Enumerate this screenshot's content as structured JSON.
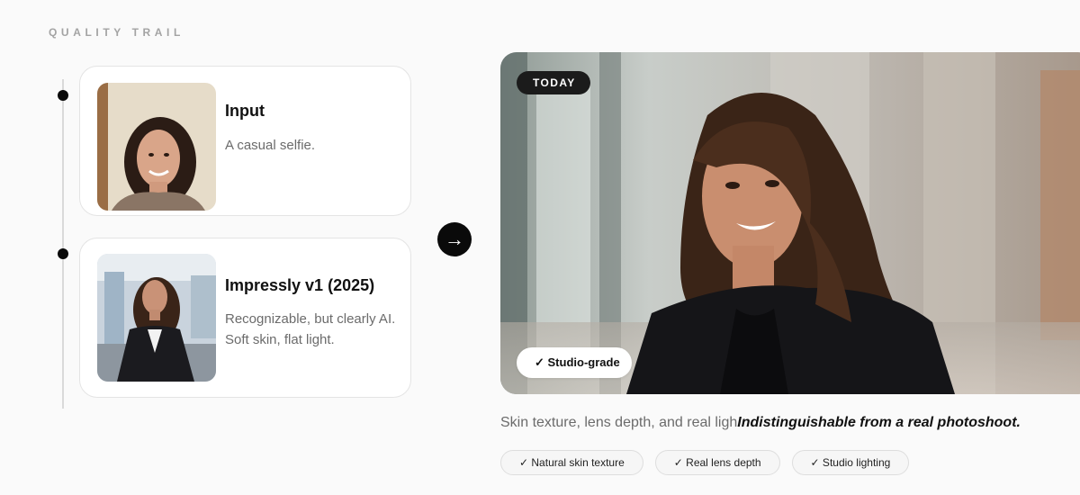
{
  "section_label": "QUALITY TRAIL",
  "timeline": [
    {
      "title": "Input",
      "description_lines": [
        "A casual selfie."
      ],
      "image_alt": "casual selfie photo"
    },
    {
      "title": "Impressly v1 (2025)",
      "description_lines": [
        "Recognizable, but clearly AI.",
        "Soft skin, flat light."
      ],
      "image_alt": "AI headshot in office"
    }
  ],
  "arrow_icon": "arrow-right-icon",
  "hero": {
    "badge_top": "TODAY",
    "badge_bottom": "✓ Studio-grade"
  },
  "caption": {
    "plain": "Skin texture, lens depth, and real ligh",
    "emphasis": "Indistinguishable from a real photoshoot."
  },
  "chips": [
    "✓ Natural skin texture",
    "✓ Real lens depth",
    "✓ Studio lighting"
  ],
  "colors": {
    "accent": "#0a0a0a",
    "muted_text": "#6b6b6b",
    "card_border": "#e4e4e4",
    "background": "#fafafa"
  }
}
